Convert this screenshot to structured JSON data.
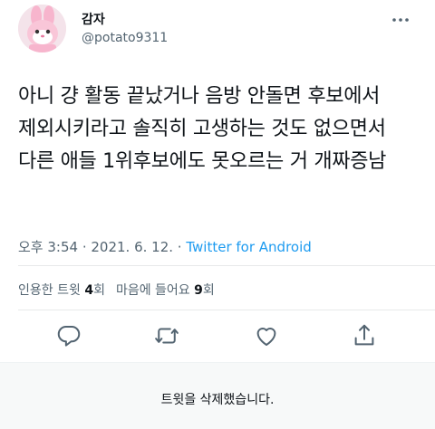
{
  "user": {
    "display_name": "감자",
    "handle": "@potato9311"
  },
  "tweet": {
    "text": "아니 걍 활동 끝났거나 음방 안돌면 후보에서 제외시키라고 솔직히 고생하는 것도 없으면서 다른 애들 1위후보에도 못오르는 거 개짜증남",
    "time": "오후 3:54",
    "sep1": " · ",
    "date": "2021. 6. 12.",
    "sep2": " · ",
    "source": "Twitter for Android"
  },
  "stats": {
    "quote_label": "인용한 트윗",
    "quote_count": "4",
    "quote_unit": "회",
    "like_label": "마음에 들어요",
    "like_count": "9",
    "like_unit": "회"
  },
  "actions": [
    {
      "icon": "reply-icon"
    },
    {
      "icon": "retweet-icon"
    },
    {
      "icon": "like-icon"
    },
    {
      "icon": "share-icon"
    }
  ],
  "notice": {
    "deleted_text": "트윗을 삭제했습니다."
  },
  "colors": {
    "text": "#0f1419",
    "secondary": "#536471",
    "link": "#1d9bf0",
    "divider": "#e7e9ea"
  }
}
